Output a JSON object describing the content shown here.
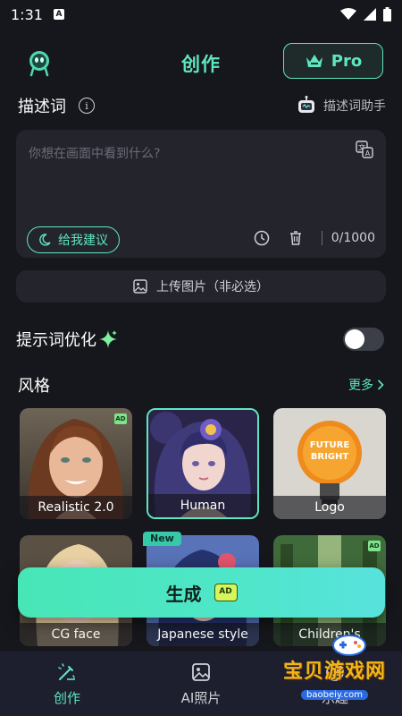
{
  "status_bar": {
    "time": "1:31",
    "a_badge": "A"
  },
  "header": {
    "title": "创作",
    "pro_label": "Pro"
  },
  "description": {
    "title": "描述词",
    "assistant_label": "描述词助手",
    "placeholder": "你想在画面中看到什么?",
    "suggest_label": "给我建议",
    "char_count": "0/1000"
  },
  "upload": {
    "label": "上传图片（非必选）"
  },
  "optimize": {
    "label": "提示词优化",
    "enabled": false
  },
  "styles": {
    "title": "风格",
    "more_label": "更多",
    "ad_badge": "AD",
    "new_badge": "New",
    "cards": [
      {
        "label": "Realistic 2.0",
        "ad": true,
        "selected": false
      },
      {
        "label": "Human",
        "ad": false,
        "selected": true
      },
      {
        "label": "Logo",
        "ad": false,
        "selected": false
      },
      {
        "label": "CG face",
        "ad": false,
        "selected": false
      },
      {
        "label": "Japanese style",
        "ad": false,
        "selected": false
      },
      {
        "label": "Children's illustra...",
        "ad": true,
        "selected": false
      }
    ],
    "logo_card_text": "FUTURE BRIGHT"
  },
  "generate": {
    "label": "生成",
    "ad_badge": "AD"
  },
  "bottom_nav": {
    "items": [
      {
        "label": "创作",
        "active": true
      },
      {
        "label": "AI照片",
        "active": false
      },
      {
        "label": "乐趣",
        "active": false
      }
    ]
  },
  "watermark": {
    "big": "宝贝游戏网",
    "small": "baobeiy.com"
  },
  "colors": {
    "accent": "#5ee6c1",
    "background": "#16171c",
    "surface": "#24252c"
  }
}
